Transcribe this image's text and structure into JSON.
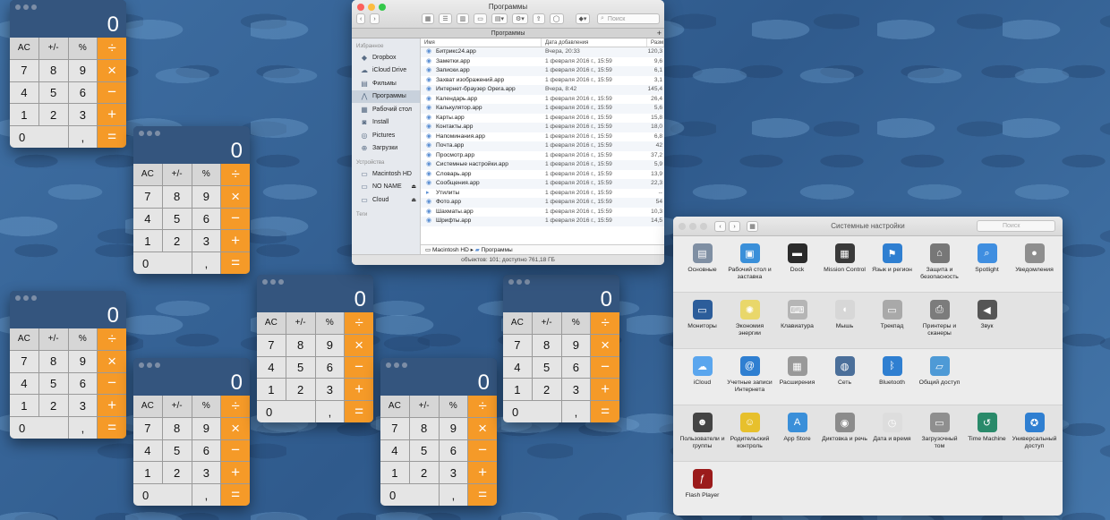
{
  "calculator": {
    "display": "0",
    "keys": [
      {
        "label": "AC",
        "kind": "fn",
        "name": "ac"
      },
      {
        "label": "+/-",
        "kind": "fn",
        "name": "sign"
      },
      {
        "label": "%",
        "kind": "fn",
        "name": "percent"
      },
      {
        "label": "÷",
        "kind": "op",
        "name": "divide"
      },
      {
        "label": "7",
        "kind": "num",
        "name": "7"
      },
      {
        "label": "8",
        "kind": "num",
        "name": "8"
      },
      {
        "label": "9",
        "kind": "num",
        "name": "9"
      },
      {
        "label": "×",
        "kind": "op",
        "name": "multiply"
      },
      {
        "label": "4",
        "kind": "num",
        "name": "4"
      },
      {
        "label": "5",
        "kind": "num",
        "name": "5"
      },
      {
        "label": "6",
        "kind": "num",
        "name": "6"
      },
      {
        "label": "−",
        "kind": "op",
        "name": "minus"
      },
      {
        "label": "1",
        "kind": "num",
        "name": "1"
      },
      {
        "label": "2",
        "kind": "num",
        "name": "2"
      },
      {
        "label": "3",
        "kind": "num",
        "name": "3"
      },
      {
        "label": "+",
        "kind": "op",
        "name": "plus"
      },
      {
        "label": "0",
        "kind": "zero",
        "name": "0"
      },
      {
        "label": ",",
        "kind": "num",
        "name": "decimal"
      },
      {
        "label": "=",
        "kind": "op",
        "name": "equals"
      }
    ],
    "accent_color": "#f59a28"
  },
  "finder": {
    "title": "Программы",
    "search_placeholder": "Поиск",
    "tab_label": "Программы",
    "sidebar": {
      "favorites_header": "Избранное",
      "favorites": [
        {
          "label": "Dropbox",
          "icon": "dropbox-icon",
          "glyph": "◆"
        },
        {
          "label": "iCloud Drive",
          "icon": "cloud-icon",
          "glyph": "☁"
        },
        {
          "label": "Фильмы",
          "icon": "film-icon",
          "glyph": "▤"
        },
        {
          "label": "Программы",
          "icon": "apps-icon",
          "glyph": "⋀",
          "selected": true
        },
        {
          "label": "Рабочий стол",
          "icon": "desktop-icon",
          "glyph": "▦"
        },
        {
          "label": "Install",
          "icon": "folder-icon",
          "glyph": "◙"
        },
        {
          "label": "Pictures",
          "icon": "camera-icon",
          "glyph": "◎"
        },
        {
          "label": "Загрузки",
          "icon": "download-icon",
          "glyph": "⊕"
        }
      ],
      "devices_header": "Устройства",
      "devices": [
        {
          "label": "Macintosh HD",
          "icon": "disk-icon",
          "glyph": "▭"
        },
        {
          "label": "NO NAME",
          "icon": "disk-icon",
          "glyph": "▭",
          "eject": "⏏"
        },
        {
          "label": "Cloud",
          "icon": "disk-icon",
          "glyph": "▭",
          "eject": "⏏"
        }
      ],
      "tags_header": "Теги"
    },
    "columns": {
      "name": "Имя",
      "date": "Дата добавления",
      "size": "Разм"
    },
    "files": [
      {
        "name": "Битрикс24.app",
        "date": "Вчера, 20:33",
        "size": "120,3"
      },
      {
        "name": "Заметки.app",
        "date": "1 февраля 2016 г., 15:59",
        "size": "9,6"
      },
      {
        "name": "Записки.app",
        "date": "1 февраля 2016 г., 15:59",
        "size": "6,1"
      },
      {
        "name": "Захват изображений.app",
        "date": "1 февраля 2016 г., 15:59",
        "size": "3,1"
      },
      {
        "name": "Интернет-браузер Opera.app",
        "date": "Вчера, 8:42",
        "size": "145,4"
      },
      {
        "name": "Календарь.app",
        "date": "1 февраля 2016 г., 15:59",
        "size": "26,4"
      },
      {
        "name": "Калькулятор.app",
        "date": "1 февраля 2016 г., 15:59",
        "size": "5,6"
      },
      {
        "name": "Карты.app",
        "date": "1 февраля 2016 г., 15:59",
        "size": "15,8"
      },
      {
        "name": "Контакты.app",
        "date": "1 февраля 2016 г., 15:59",
        "size": "18,0"
      },
      {
        "name": "Напоминания.app",
        "date": "1 февраля 2016 г., 15:59",
        "size": "6,8"
      },
      {
        "name": "Почта.app",
        "date": "1 февраля 2016 г., 15:59",
        "size": "42"
      },
      {
        "name": "Просмотр.app",
        "date": "1 февраля 2016 г., 15:59",
        "size": "37,2"
      },
      {
        "name": "Системные настройки.app",
        "date": "1 февраля 2016 г., 15:59",
        "size": "5,9"
      },
      {
        "name": "Словарь.app",
        "date": "1 февраля 2016 г., 15:59",
        "size": "13,9"
      },
      {
        "name": "Сообщения.app",
        "date": "1 февраля 2016 г., 15:59",
        "size": "22,3"
      },
      {
        "name": "Утилиты",
        "date": "1 февраля 2016 г., 15:59",
        "size": "--"
      },
      {
        "name": "Фото.app",
        "date": "1 февраля 2016 г., 15:59",
        "size": "54"
      },
      {
        "name": "Шахматы.app",
        "date": "1 февраля 2016 г., 15:59",
        "size": "10,3"
      },
      {
        "name": "Шрифты.app",
        "date": "1 февраля 2016 г., 15:59",
        "size": "14,5"
      }
    ],
    "path": [
      "Macintosh HD",
      "Программы"
    ],
    "status": "объектов: 101; доступно 761,18 ГБ"
  },
  "prefs": {
    "title": "Системные настройки",
    "search_placeholder": "Поиск",
    "sections": [
      [
        {
          "label": "Основные",
          "icon": "general-icon",
          "color": "#7f8fa3",
          "glyph": "▤"
        },
        {
          "label": "Рабочий стол и заставка",
          "icon": "desktop-screensaver-icon",
          "color": "#3a8fd9",
          "glyph": "▣"
        },
        {
          "label": "Dock",
          "icon": "dock-icon",
          "color": "#2b2b2b",
          "glyph": "▬"
        },
        {
          "label": "Mission Control",
          "icon": "mission-control-icon",
          "color": "#3a3a3a",
          "glyph": "▦"
        },
        {
          "label": "Язык и регион",
          "icon": "language-icon",
          "color": "#2f7fd1",
          "glyph": "⚑"
        },
        {
          "label": "Защита и безопасность",
          "icon": "security-icon",
          "color": "#777",
          "glyph": "⌂"
        },
        {
          "label": "Spotlight",
          "icon": "spotlight-icon",
          "color": "#3f8ee0",
          "glyph": "⌕"
        },
        {
          "label": "Уведомления",
          "icon": "notifications-icon",
          "color": "#8e8e8e",
          "glyph": "●"
        }
      ],
      [
        {
          "label": "Мониторы",
          "icon": "displays-icon",
          "color": "#2c5d9a",
          "glyph": "▭"
        },
        {
          "label": "Экономия энергии",
          "icon": "energy-icon",
          "color": "#e9d76a",
          "glyph": "✺"
        },
        {
          "label": "Клавиатура",
          "icon": "keyboard-icon",
          "color": "#b5b5b5",
          "glyph": "⌨"
        },
        {
          "label": "Мышь",
          "icon": "mouse-icon",
          "color": "#d7d7d7",
          "glyph": "◖"
        },
        {
          "label": "Трекпад",
          "icon": "trackpad-icon",
          "color": "#a9a9a9",
          "glyph": "▭"
        },
        {
          "label": "Принтеры и сканеры",
          "icon": "printer-icon",
          "color": "#7c7c7c",
          "glyph": "⎙"
        },
        {
          "label": "Звук",
          "icon": "sound-icon",
          "color": "#555",
          "glyph": "◀"
        }
      ],
      [
        {
          "label": "iCloud",
          "icon": "icloud-icon",
          "color": "#5aa6ee",
          "glyph": "☁"
        },
        {
          "label": "Учетные записи Интернета",
          "icon": "internet-accounts-icon",
          "color": "#2f7fd1",
          "glyph": "@"
        },
        {
          "label": "Расширения",
          "icon": "extensions-icon",
          "color": "#999",
          "glyph": "▦"
        },
        {
          "label": "Сеть",
          "icon": "network-icon",
          "color": "#4b6f9a",
          "glyph": "◍"
        },
        {
          "label": "Bluetooth",
          "icon": "bluetooth-icon",
          "color": "#2f7fd1",
          "glyph": "ᛒ"
        },
        {
          "label": "Общий доступ",
          "icon": "sharing-icon",
          "color": "#4e9ad6",
          "glyph": "▱"
        }
      ],
      [
        {
          "label": "Пользователи и группы",
          "icon": "users-icon",
          "color": "#444",
          "glyph": "☻"
        },
        {
          "label": "Родительский контроль",
          "icon": "parental-icon",
          "color": "#e7c02c",
          "glyph": "☺"
        },
        {
          "label": "App Store",
          "icon": "app-store-icon",
          "color": "#3a8fd9",
          "glyph": "A"
        },
        {
          "label": "Диктовка и речь",
          "icon": "dictation-icon",
          "color": "#8c8c8c",
          "glyph": "◉"
        },
        {
          "label": "Дата и время",
          "icon": "clock-icon",
          "color": "#ddd",
          "glyph": "◷"
        },
        {
          "label": "Загрузочный том",
          "icon": "startup-disk-icon",
          "color": "#8f8f8f",
          "glyph": "▭"
        },
        {
          "label": "Time Machine",
          "icon": "time-machine-icon",
          "color": "#2a8a6a",
          "glyph": "↺"
        },
        {
          "label": "Универсальный доступ",
          "icon": "accessibility-icon",
          "color": "#2f7fd1",
          "glyph": "✪"
        }
      ],
      [
        {
          "label": "Flash Player",
          "icon": "flash-icon",
          "color": "#9b1b1b",
          "glyph": "ƒ"
        }
      ]
    ]
  }
}
